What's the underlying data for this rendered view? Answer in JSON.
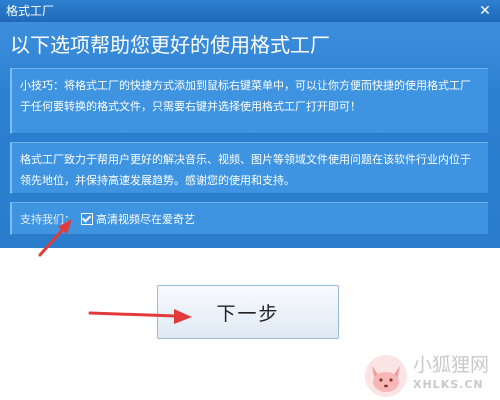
{
  "window": {
    "title": "格式工厂",
    "close_icon": "close-icon"
  },
  "main": {
    "heading": "以下选项帮助您更好的使用格式工厂",
    "tip_text": "小技巧：将格式工厂的快捷方式添加到鼠标右键菜单中，可以让你方便而快捷的使用格式工厂于任何要转换的格式文件，只需要右键并选择使用格式工厂打开即可！",
    "description_text": "格式工厂致力于帮用户更好的解决音乐、视频、图片等领域文件使用问题在该软件行业内位于领先地位，并保持高速发展趋势。感谢您的使用和支持。",
    "support_label": "支持我们：",
    "support_option_label": "高清视频尽在爱奇艺",
    "support_option_checked": true
  },
  "buttons": {
    "next_label": "下一步"
  },
  "watermark": {
    "cn_text": "小狐狸网",
    "en_text": "XHLKS.CN"
  },
  "colors": {
    "panel_blue": "#2b7fd0",
    "infobox_blue": "#3f94e1",
    "annotation_red": "#e23a3a"
  }
}
